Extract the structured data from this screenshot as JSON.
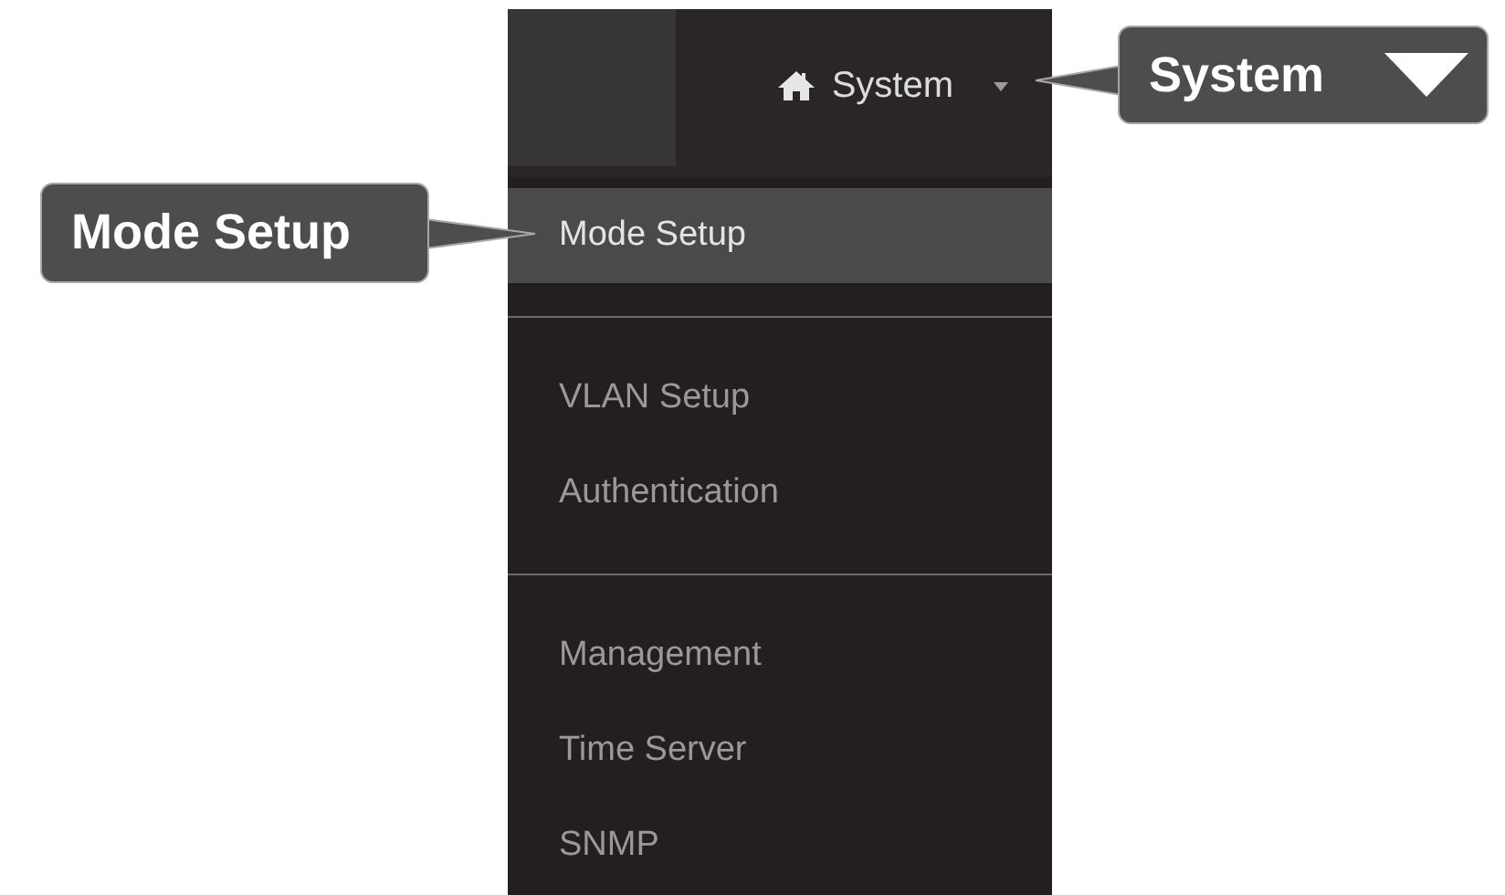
{
  "navbar": {
    "label": "System"
  },
  "menu": {
    "groups": [
      {
        "items": [
          {
            "label": "Mode Setup",
            "selected": true
          }
        ]
      },
      {
        "items": [
          {
            "label": "VLAN Setup",
            "selected": false
          },
          {
            "label": "Authentication",
            "selected": false
          }
        ]
      },
      {
        "items": [
          {
            "label": "Management",
            "selected": false
          },
          {
            "label": "Time Server",
            "selected": false
          },
          {
            "label": "SNMP",
            "selected": false
          }
        ]
      }
    ]
  },
  "callouts": [
    {
      "label": "System",
      "kind": "dropdown"
    },
    {
      "label": "Mode Setup",
      "kind": "plain"
    }
  ]
}
